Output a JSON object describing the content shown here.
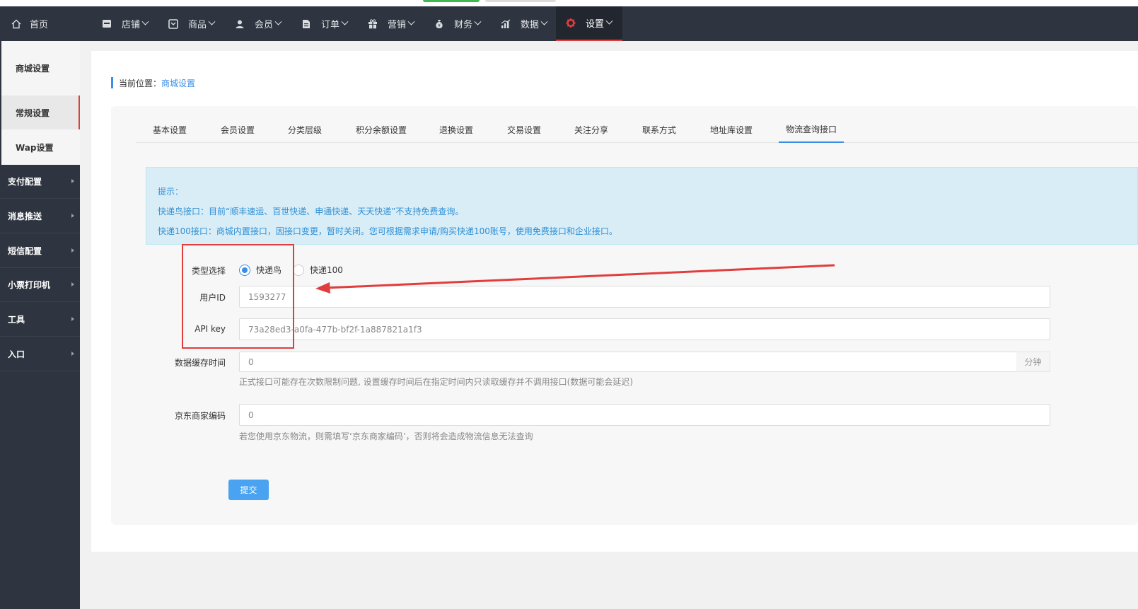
{
  "nav": {
    "home": "首页",
    "items": [
      "店铺",
      "商品",
      "会员",
      "订单",
      "营销",
      "财务",
      "数据",
      "设置"
    ]
  },
  "sidebar": {
    "sub": [
      "商城设置",
      "常规设置",
      "Wap设置"
    ],
    "items": [
      "支付配置",
      "消息推送",
      "短信配置",
      "小票打印机",
      "工具",
      "入口"
    ]
  },
  "breadcrumb": {
    "prefix": "当前位置：",
    "current": "商城设置"
  },
  "tabs": [
    "基本设置",
    "会员设置",
    "分类层级",
    "积分余额设置",
    "退换设置",
    "交易设置",
    "关注分享",
    "联系方式",
    "地址库设置",
    "物流查询接口"
  ],
  "tip": {
    "title": "提示：",
    "line1": "快递鸟接口：目前“顺丰速运、百世快递、申通快递、天天快递”不支持免费查询。",
    "line2": "快递100接口：商城内置接口，因接口变更，暂时关闭。您可根据需求申请/购买快递100账号，使用免费接口和企业接口。"
  },
  "form": {
    "type_label": "类型选择",
    "type_options": [
      "快递鸟",
      "快递100"
    ],
    "user_id_label": "用户ID",
    "user_id_value": "1593277",
    "api_key_label": "API key",
    "api_key_value": "73a28ed3-a0fa-477b-bf2f-1a887821a1f3",
    "cache_label": "数据缓存时间",
    "cache_value": "0",
    "cache_unit": "分钟",
    "cache_help": "正式接口可能存在次数限制问题, 设置缓存时间后在指定时间内只读取缓存并不调用接口(数据可能会延迟)",
    "jd_label": "京东商家编码",
    "jd_value": "0",
    "jd_help": "若您使用京东物流，则需填写‘京东商家编码’，否则将会造成物流信息无法查询",
    "submit": "提交"
  },
  "colors": {
    "nav_bg": "#2f3540",
    "accent": "#3a8ee6",
    "active_red": "#e23d3d"
  }
}
